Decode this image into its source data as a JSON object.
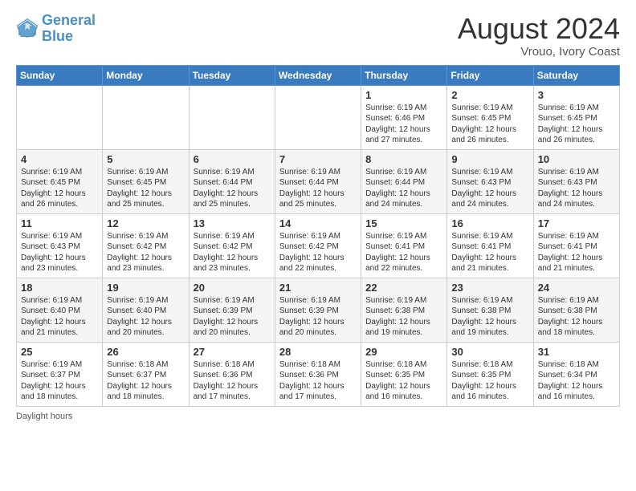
{
  "logo": {
    "text_general": "General",
    "text_blue": "Blue"
  },
  "header": {
    "month": "August 2024",
    "location": "Vrouo, Ivory Coast"
  },
  "days_of_week": [
    "Sunday",
    "Monday",
    "Tuesday",
    "Wednesday",
    "Thursday",
    "Friday",
    "Saturday"
  ],
  "footer": {
    "daylight_label": "Daylight hours"
  },
  "weeks": [
    [
      {
        "day": "",
        "info": ""
      },
      {
        "day": "",
        "info": ""
      },
      {
        "day": "",
        "info": ""
      },
      {
        "day": "",
        "info": ""
      },
      {
        "day": "1",
        "info": "Sunrise: 6:19 AM\nSunset: 6:46 PM\nDaylight: 12 hours\nand 27 minutes."
      },
      {
        "day": "2",
        "info": "Sunrise: 6:19 AM\nSunset: 6:45 PM\nDaylight: 12 hours\nand 26 minutes."
      },
      {
        "day": "3",
        "info": "Sunrise: 6:19 AM\nSunset: 6:45 PM\nDaylight: 12 hours\nand 26 minutes."
      }
    ],
    [
      {
        "day": "4",
        "info": "Sunrise: 6:19 AM\nSunset: 6:45 PM\nDaylight: 12 hours\nand 26 minutes."
      },
      {
        "day": "5",
        "info": "Sunrise: 6:19 AM\nSunset: 6:45 PM\nDaylight: 12 hours\nand 25 minutes."
      },
      {
        "day": "6",
        "info": "Sunrise: 6:19 AM\nSunset: 6:44 PM\nDaylight: 12 hours\nand 25 minutes."
      },
      {
        "day": "7",
        "info": "Sunrise: 6:19 AM\nSunset: 6:44 PM\nDaylight: 12 hours\nand 25 minutes."
      },
      {
        "day": "8",
        "info": "Sunrise: 6:19 AM\nSunset: 6:44 PM\nDaylight: 12 hours\nand 24 minutes."
      },
      {
        "day": "9",
        "info": "Sunrise: 6:19 AM\nSunset: 6:43 PM\nDaylight: 12 hours\nand 24 minutes."
      },
      {
        "day": "10",
        "info": "Sunrise: 6:19 AM\nSunset: 6:43 PM\nDaylight: 12 hours\nand 24 minutes."
      }
    ],
    [
      {
        "day": "11",
        "info": "Sunrise: 6:19 AM\nSunset: 6:43 PM\nDaylight: 12 hours\nand 23 minutes."
      },
      {
        "day": "12",
        "info": "Sunrise: 6:19 AM\nSunset: 6:42 PM\nDaylight: 12 hours\nand 23 minutes."
      },
      {
        "day": "13",
        "info": "Sunrise: 6:19 AM\nSunset: 6:42 PM\nDaylight: 12 hours\nand 23 minutes."
      },
      {
        "day": "14",
        "info": "Sunrise: 6:19 AM\nSunset: 6:42 PM\nDaylight: 12 hours\nand 22 minutes."
      },
      {
        "day": "15",
        "info": "Sunrise: 6:19 AM\nSunset: 6:41 PM\nDaylight: 12 hours\nand 22 minutes."
      },
      {
        "day": "16",
        "info": "Sunrise: 6:19 AM\nSunset: 6:41 PM\nDaylight: 12 hours\nand 21 minutes."
      },
      {
        "day": "17",
        "info": "Sunrise: 6:19 AM\nSunset: 6:41 PM\nDaylight: 12 hours\nand 21 minutes."
      }
    ],
    [
      {
        "day": "18",
        "info": "Sunrise: 6:19 AM\nSunset: 6:40 PM\nDaylight: 12 hours\nand 21 minutes."
      },
      {
        "day": "19",
        "info": "Sunrise: 6:19 AM\nSunset: 6:40 PM\nDaylight: 12 hours\nand 20 minutes."
      },
      {
        "day": "20",
        "info": "Sunrise: 6:19 AM\nSunset: 6:39 PM\nDaylight: 12 hours\nand 20 minutes."
      },
      {
        "day": "21",
        "info": "Sunrise: 6:19 AM\nSunset: 6:39 PM\nDaylight: 12 hours\nand 20 minutes."
      },
      {
        "day": "22",
        "info": "Sunrise: 6:19 AM\nSunset: 6:38 PM\nDaylight: 12 hours\nand 19 minutes."
      },
      {
        "day": "23",
        "info": "Sunrise: 6:19 AM\nSunset: 6:38 PM\nDaylight: 12 hours\nand 19 minutes."
      },
      {
        "day": "24",
        "info": "Sunrise: 6:19 AM\nSunset: 6:38 PM\nDaylight: 12 hours\nand 18 minutes."
      }
    ],
    [
      {
        "day": "25",
        "info": "Sunrise: 6:19 AM\nSunset: 6:37 PM\nDaylight: 12 hours\nand 18 minutes."
      },
      {
        "day": "26",
        "info": "Sunrise: 6:18 AM\nSunset: 6:37 PM\nDaylight: 12 hours\nand 18 minutes."
      },
      {
        "day": "27",
        "info": "Sunrise: 6:18 AM\nSunset: 6:36 PM\nDaylight: 12 hours\nand 17 minutes."
      },
      {
        "day": "28",
        "info": "Sunrise: 6:18 AM\nSunset: 6:36 PM\nDaylight: 12 hours\nand 17 minutes."
      },
      {
        "day": "29",
        "info": "Sunrise: 6:18 AM\nSunset: 6:35 PM\nDaylight: 12 hours\nand 16 minutes."
      },
      {
        "day": "30",
        "info": "Sunrise: 6:18 AM\nSunset: 6:35 PM\nDaylight: 12 hours\nand 16 minutes."
      },
      {
        "day": "31",
        "info": "Sunrise: 6:18 AM\nSunset: 6:34 PM\nDaylight: 12 hours\nand 16 minutes."
      }
    ]
  ]
}
